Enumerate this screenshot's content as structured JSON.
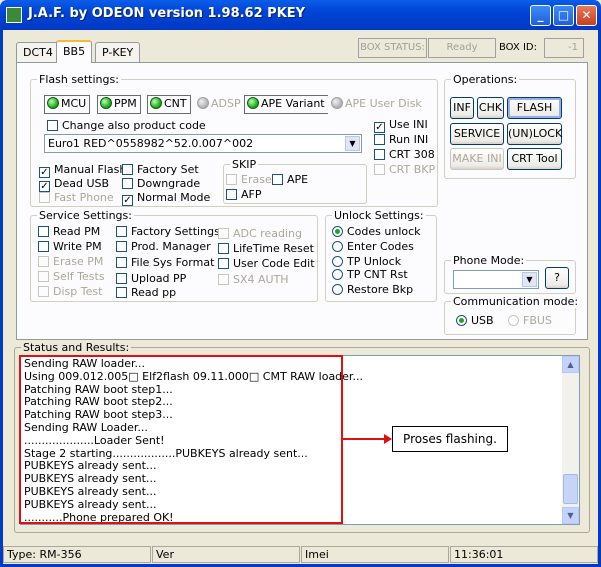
{
  "window": {
    "title": "J.A.F. by ODEON version 1.98.62 PKEY",
    "minimize": "_",
    "maximize": "□",
    "close": "✕"
  },
  "tabs": [
    {
      "label": "DCT4"
    },
    {
      "label": "BB5"
    },
    {
      "label": "P-KEY"
    }
  ],
  "box": {
    "status_label": "BOX STATUS:",
    "status_value": "Ready",
    "id_label": "BOX ID:",
    "id_value": "-1"
  },
  "flash_settings": {
    "title": "Flash settings:",
    "leds": [
      {
        "label": "MCU",
        "on": true
      },
      {
        "label": "PPM",
        "on": true
      },
      {
        "label": "CNT",
        "on": true
      },
      {
        "label": "ADSP",
        "on": false
      },
      {
        "label": "APE Variant",
        "on": true
      },
      {
        "label": "APE User Disk",
        "on": false
      }
    ],
    "change_product_code": "Change also product code",
    "product_code": "Euro1 RED^0558982^52.0.007^002",
    "use_ini": "Use INI",
    "run_ini": "Run INI",
    "crt308": "CRT 308",
    "crt_bkp": "CRT BKP",
    "manual_flash": "Manual Flash",
    "dead_usb": "Dead USB",
    "fast_phone": "Fast Phone",
    "factory_set": "Factory Set",
    "downgrade": "Downgrade",
    "normal_mode": "Normal Mode",
    "skip_title": "SKIP",
    "skip_erase": "Erase",
    "skip_ape": "APE",
    "skip_afp": "AFP"
  },
  "operations": {
    "title": "Operations:",
    "inf": "INF",
    "chk": "CHK",
    "flash": "FLASH",
    "service": "SERVICE",
    "unlock": "(UN)LOCK",
    "make_ini": "MAKE INI",
    "crt_tool": "CRT Tool"
  },
  "service_settings": {
    "title": "Service Settings:",
    "read_pm": "Read PM",
    "write_pm": "Write PM",
    "erase_pm": "Erase PM",
    "self_tests": "Self Tests",
    "disp_test": "Disp Test",
    "factory_settings": "Factory Settings",
    "prod_manager": "Prod. Manager",
    "file_sys_format": "File Sys Format",
    "upload_pp": "Upload PP",
    "read_pp": "Read pp",
    "adc_reading": "ADC reading",
    "lifetime_reset": "LifeTime Reset",
    "user_code_edit": "User Code Edit",
    "sx4_auth": "SX4 AUTH"
  },
  "unlock_settings": {
    "title": "Unlock Settings:",
    "codes_unlock": "Codes unlock",
    "enter_codes": "Enter Codes",
    "tp_unlock": "TP Unlock",
    "tp_cnt_rst": "TP CNT Rst",
    "restore_bkp": "Restore Bkp"
  },
  "phone_mode": {
    "title": "Phone Mode:",
    "value": "",
    "help": "?"
  },
  "comm_mode": {
    "title": "Communication mode:",
    "usb": "USB",
    "fbus": "FBUS"
  },
  "status_results": {
    "title": "Status and Results:",
    "lines": [
      "Sending RAW loader...",
      "Using 009.012.005□    Elf2flash 09.11.000□    CMT RAW loader...",
      "Patching RAW boot step1...",
      "Patching RAW boot step2...",
      "Patching RAW boot step3...",
      "Sending RAW Loader...",
      "....................Loader Sent!",
      "Stage 2 starting..................PUBKEYS already sent...",
      "PUBKEYS already sent...",
      "PUBKEYS already sent...",
      "PUBKEYS already sent...",
      "PUBKEYS already sent...",
      "...........Phone prepared OK!"
    ]
  },
  "annotation": {
    "callout": "Proses flashing."
  },
  "statusbar": {
    "type": "Type: RM-356",
    "ver": "Ver",
    "imei": "Imei",
    "time": "11:36:01"
  },
  "colors": {
    "titlebar": "#0a5de8",
    "annotation_red": "#e01010",
    "led_green": "#22b422"
  }
}
